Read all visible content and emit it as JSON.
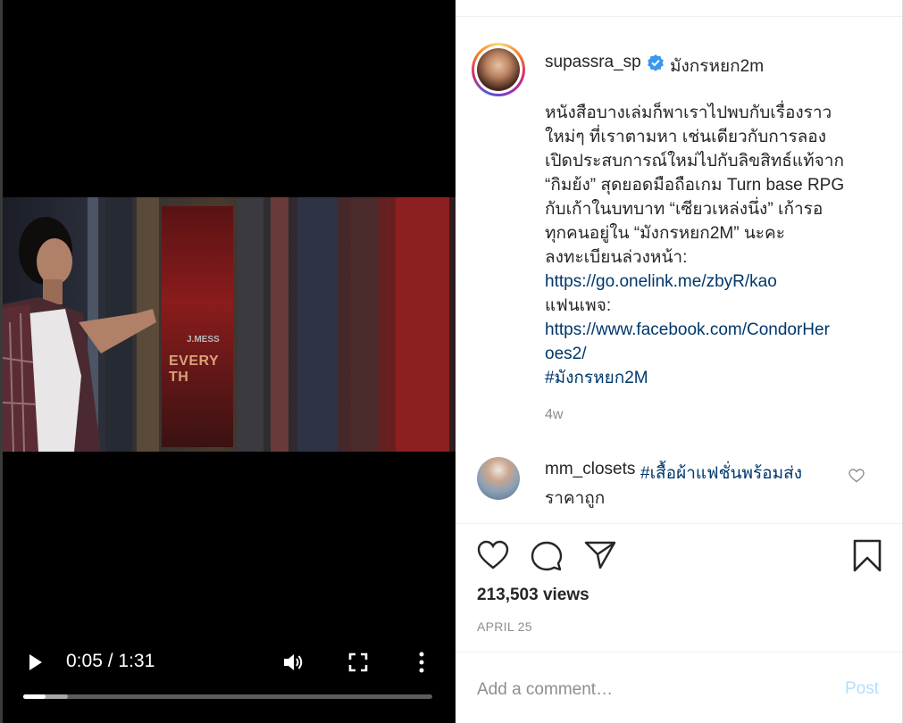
{
  "video": {
    "current_time": "0:05",
    "separator": " / ",
    "duration": "1:31",
    "played_fraction": 0.055,
    "buffered_fraction": 0.11,
    "poster_text_top": "J.MESS",
    "poster_text": "EVERY TH"
  },
  "post": {
    "username": "supassra_sp",
    "location": "มังกรหยก2m",
    "caption_lines": [
      {
        "text": "หนังสือบางเล่มก็พาเราไปพบกับเรื่องราว",
        "link": false
      },
      {
        "text": "ใหม่ๆ ที่เราตามหา เช่นเดียวกับการลอง",
        "link": false
      },
      {
        "text": "เปิดประสบการณ์ใหม่ไปกับลิขสิทธ์แท้จาก",
        "link": false
      },
      {
        "text": "“กิมย้ง” สุดยอดมือถือเกม Turn base RPG",
        "link": false
      },
      {
        "text": "กับเก้าในบทบาท “เซียวเหล่งนึ่ง” เก้ารอ",
        "link": false
      },
      {
        "text": "ทุกคนอยู่ใน “มังกรหยก2M” นะคะ",
        "link": false
      },
      {
        "text": "ลงทะเบียนล่วงหน้า:",
        "link": false
      },
      {
        "text": "https://go.onelink.me/zbyR/kao",
        "link": true
      },
      {
        "text": "แฟนเพจ:",
        "link": false
      },
      {
        "text": "https://www.facebook.com/CondorHer",
        "link": true
      },
      {
        "text": "oes2/",
        "link": true
      },
      {
        "text": "#มังกรหยก2M",
        "link": true
      }
    ],
    "age": "4w",
    "views": "213,503 views",
    "date": "APRIL 25"
  },
  "comment": {
    "username": "mm_closets",
    "tag": "#เสื้อผ้าแฟชั่นพร้อมส่ง",
    "text": "ราคาถูก"
  },
  "add_comment": {
    "placeholder": "Add a comment…",
    "post_label": "Post"
  },
  "colors": {
    "link": "#00376b",
    "verified": "#3897f0",
    "post_disabled": "#b2dffc"
  }
}
